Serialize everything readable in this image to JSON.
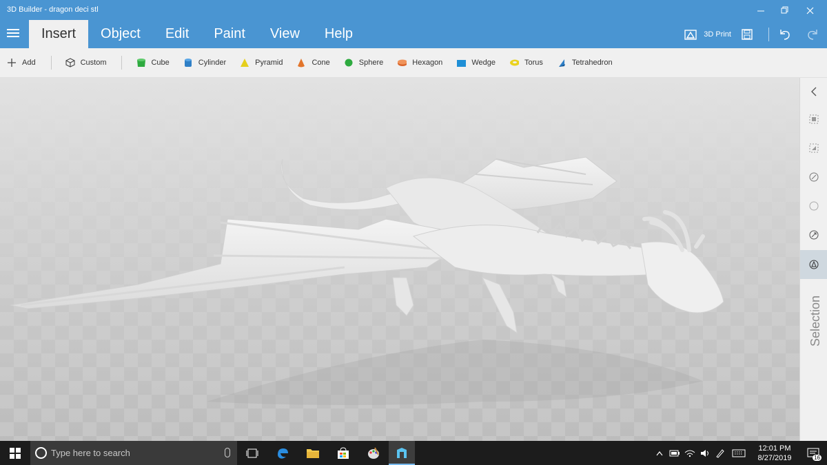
{
  "app": {
    "title": "3D Builder - dragon deci stl",
    "window_buttons": [
      "minimize",
      "restore",
      "close"
    ]
  },
  "menu": {
    "tabs": [
      {
        "label": "Insert",
        "active": true
      },
      {
        "label": "Object",
        "active": false
      },
      {
        "label": "Edit",
        "active": false
      },
      {
        "label": "Paint",
        "active": false
      },
      {
        "label": "View",
        "active": false
      },
      {
        "label": "Help",
        "active": false
      }
    ],
    "print_label": "3D Print"
  },
  "toolbar": {
    "add_label": "Add",
    "custom_label": "Custom",
    "shapes": [
      {
        "label": "Cube",
        "icon": "cube-icon",
        "color": "#2eaa3f"
      },
      {
        "label": "Cylinder",
        "icon": "cylinder-icon",
        "color": "#2f7fc6"
      },
      {
        "label": "Pyramid",
        "icon": "pyramid-icon",
        "color": "#e5cf1c"
      },
      {
        "label": "Cone",
        "icon": "cone-icon",
        "color": "#e2752b"
      },
      {
        "label": "Sphere",
        "icon": "sphere-icon",
        "color": "#2eaa3f"
      },
      {
        "label": "Hexagon",
        "icon": "hexagon-icon",
        "color": "#e67a3d"
      },
      {
        "label": "Wedge",
        "icon": "wedge-icon",
        "color": "#1f8fd6"
      },
      {
        "label": "Torus",
        "icon": "torus-icon",
        "color": "#ead21e"
      },
      {
        "label": "Tetrahedron",
        "icon": "tetrahedron-icon",
        "color": "#2f7fc6"
      }
    ]
  },
  "side_panel": {
    "label": "Selection",
    "buttons": [
      "collapse-chevron-icon",
      "select-objects-icon",
      "select-faces-icon",
      "select-edges-icon",
      "select-vertices-icon",
      "select-snap-icon",
      "selection-mode-icon"
    ]
  },
  "taskbar": {
    "search_placeholder": "Type here to search",
    "time": "12:01 PM",
    "date": "8/27/2019",
    "notification_count": "16"
  },
  "colors": {
    "accent": "#4a95d2",
    "toolbar_bg": "#f0f0f0",
    "taskbar_bg": "#1c1c1c"
  }
}
